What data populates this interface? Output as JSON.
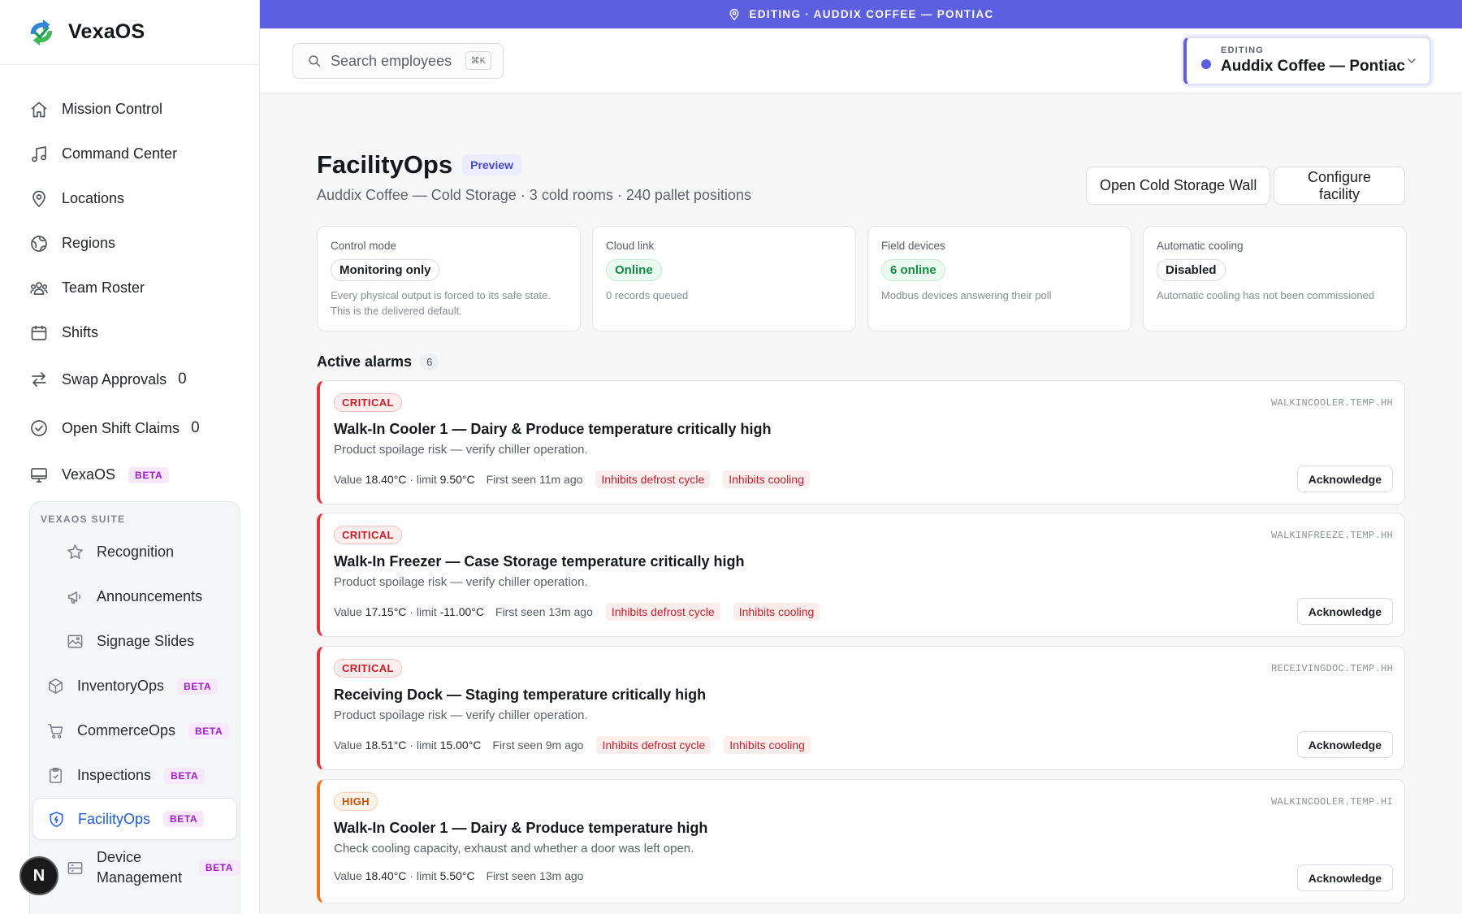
{
  "app": {
    "name": "VexaOS"
  },
  "banner": {
    "text": "EDITING · AUDDIX COFFEE — PONTIAC"
  },
  "search": {
    "placeholder": "Search employees",
    "shortcut": "⌘K"
  },
  "context": {
    "label": "EDITING",
    "value": "Auddix Coffee — Pontiac"
  },
  "sidebar": {
    "items": [
      {
        "label": "Mission Control",
        "icon": "home-icon"
      },
      {
        "label": "Command Center",
        "icon": "music-note-icon"
      },
      {
        "label": "Locations",
        "icon": "map-pin-icon"
      },
      {
        "label": "Regions",
        "icon": "globe-icon"
      },
      {
        "label": "Team Roster",
        "icon": "users-icon"
      },
      {
        "label": "Shifts",
        "icon": "calendar-icon"
      },
      {
        "label": "Swap Approvals",
        "icon": "swap-arrows-icon",
        "count": "0"
      },
      {
        "label": "Open Shift Claims",
        "icon": "check-circle-icon",
        "count": "0"
      },
      {
        "label": "VexaOS",
        "icon": "monitor-icon",
        "badge": "BETA"
      }
    ],
    "suite": {
      "title": "VEXAOS SUITE",
      "items": [
        {
          "label": "Recognition",
          "icon": "star-icon"
        },
        {
          "label": "Announcements",
          "icon": "megaphone-icon"
        },
        {
          "label": "Signage Slides",
          "icon": "image-icon"
        },
        {
          "label": "InventoryOps",
          "icon": "box-icon",
          "badge": "BETA"
        },
        {
          "label": "CommerceOps",
          "icon": "cart-icon",
          "badge": "BETA"
        },
        {
          "label": "Inspections",
          "icon": "clipboard-icon",
          "badge": "BETA"
        },
        {
          "label": "FacilityOps",
          "icon": "shield-icon",
          "badge": "BETA"
        },
        {
          "label": "Device Management",
          "icon": "server-icon",
          "badge": "BETA"
        }
      ]
    },
    "avatar": "N"
  },
  "page": {
    "title": "FacilityOps",
    "badge": "Preview",
    "subtitle": "Auddix Coffee — Cold Storage · 3 cold rooms · 240 pallet positions",
    "buttons": {
      "open_wall": "Open Cold Storage Wall",
      "configure": "Configure facility"
    }
  },
  "cards": [
    {
      "label": "Control mode",
      "pill": "Monitoring only",
      "desc": "Every physical output is forced to its safe state. This is the delivered default."
    },
    {
      "label": "Cloud link",
      "pill": "Online",
      "desc": "0 records queued"
    },
    {
      "label": "Field devices",
      "pill": "6 online",
      "desc": "Modbus devices answering their poll"
    },
    {
      "label": "Automatic cooling",
      "pill": "Disabled",
      "desc": "Automatic cooling has not been commissioned"
    }
  ],
  "alarms": {
    "heading": "Active alarms",
    "count": "6",
    "ack_label": "Acknowledge",
    "colors": {
      "critical": "#e2353c",
      "high": "#f0751c"
    },
    "items": [
      {
        "severity": "CRITICAL",
        "code": "WALKINCOOLER.TEMP.HH",
        "title": "Walk-In Cooler 1 — Dairy & Produce temperature critically high",
        "desc": "Product spoilage risk — verify chiller operation.",
        "value_label": "Value",
        "value": "18.40°C",
        "limit_label": "· limit",
        "limit": "9.50°C",
        "first_seen": "First seen 11m ago",
        "tags": [
          "Inhibits defrost cycle",
          "Inhibits cooling"
        ]
      },
      {
        "severity": "CRITICAL",
        "code": "WALKINFREEZE.TEMP.HH",
        "title": "Walk-In Freezer — Case Storage temperature critically high",
        "desc": "Product spoilage risk — verify chiller operation.",
        "value_label": "Value",
        "value": "17.15°C",
        "limit_label": "· limit",
        "limit": "-11.00°C",
        "first_seen": "First seen 13m ago",
        "tags": [
          "Inhibits defrost cycle",
          "Inhibits cooling"
        ]
      },
      {
        "severity": "CRITICAL",
        "code": "RECEIVINGDOC.TEMP.HH",
        "title": "Receiving Dock — Staging temperature critically high",
        "desc": "Product spoilage risk — verify chiller operation.",
        "value_label": "Value",
        "value": "18.51°C",
        "limit_label": "· limit",
        "limit": "15.00°C",
        "first_seen": "First seen 9m ago",
        "tags": [
          "Inhibits defrost cycle",
          "Inhibits cooling"
        ]
      },
      {
        "severity": "HIGH",
        "code": "WALKINCOOLER.TEMP.HI",
        "title": "Walk-In Cooler 1 — Dairy & Produce temperature high",
        "desc": "Check cooling capacity, exhaust and whether a door was left open.",
        "value_label": "Value",
        "value": "18.40°C",
        "limit_label": "· limit",
        "limit": "5.50°C",
        "first_seen": "First seen 13m ago",
        "tags": []
      }
    ]
  }
}
